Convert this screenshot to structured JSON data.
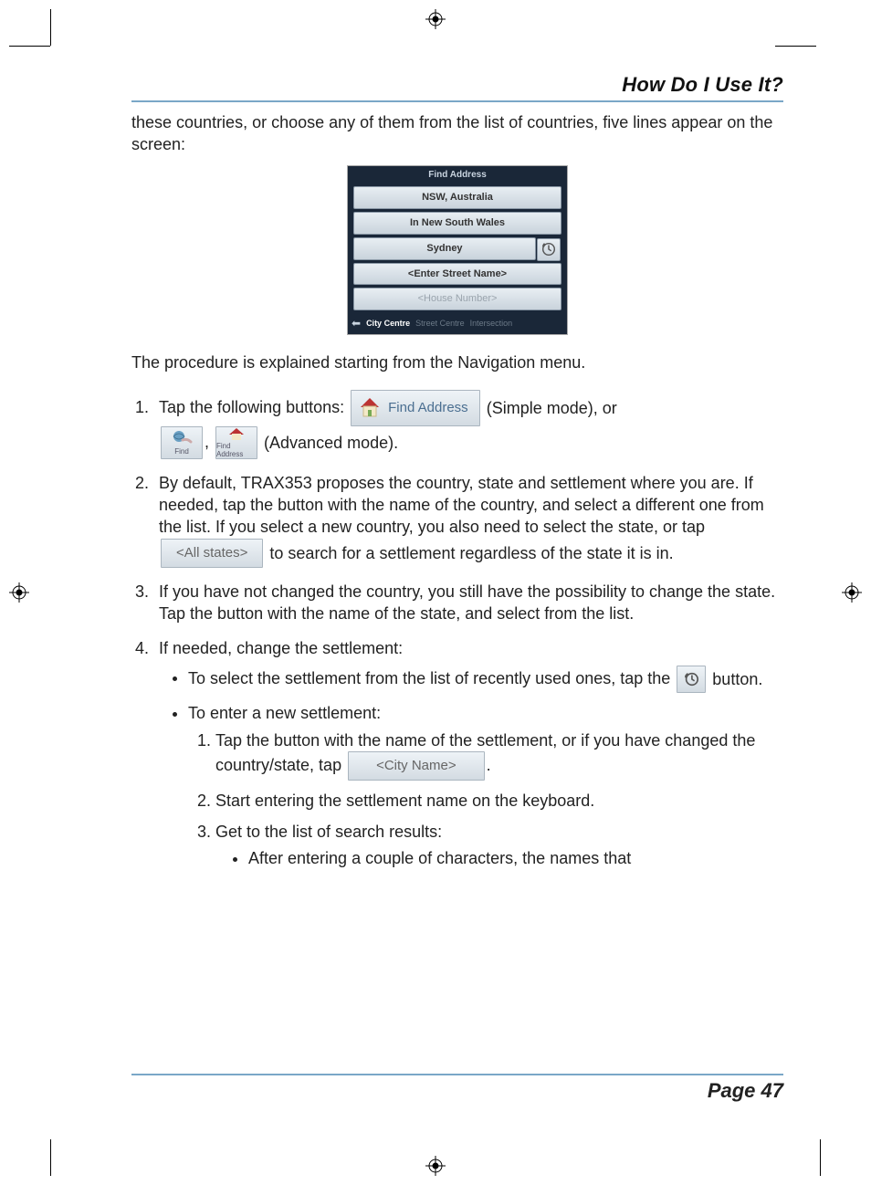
{
  "header": {
    "title": "How Do I Use It?"
  },
  "footer": {
    "label": "Page 47"
  },
  "intro": "these countries, or choose any of them from the list of countries, five lines appear on the screen:",
  "device": {
    "title": "Find Address",
    "row1": "NSW, Australia",
    "row2": "In New South Wales",
    "row3": "Sydney",
    "row4": "<Enter Street Name>",
    "row5": "<House Number>",
    "foot_active": "City Centre",
    "foot_in1": "Street Centre",
    "foot_in2": "Intersection"
  },
  "after_screenshot": "The procedure is explained starting from the Navigation menu.",
  "steps": {
    "s1_a": "Tap the following buttons: ",
    "s1_find_address": "Find Address",
    "s1_b": " (Simple mode), or ",
    "s1_find_small": "Find",
    "s1_findaddr_small": "Find Address",
    "s1_c": " (Advanced mode).",
    "s2_a": "By default, TRAX353 proposes the country, state and settlement where you are. If needed, tap the button with the name of the country, and select a different one from the list. If you select a new country, you also need to select the state, or tap ",
    "s2_chip": "<All states>",
    "s2_b": " to search for a settlement regardless of the state it is in.",
    "s3": "If you have not changed the country, you still have the possibility to change the state. Tap the button with the name of the state, and select from the list.",
    "s4": "If needed, change the settlement:",
    "s4_b1_a": "To select the settlement from the list of recently used ones, tap the ",
    "s4_b1_b": " button.",
    "s4_b2": "To enter a new settlement:",
    "s4_b2_s1_a": "Tap the button with the name of the settlement, or if you have changed the country/state, tap ",
    "s4_b2_s1_chip": "<City Name>",
    "s4_b2_s1_b": ".",
    "s4_b2_s2": "Start entering the settlement name on the keyboard.",
    "s4_b2_s3": "Get to the list of search results:",
    "s4_b2_s3_b1": "After entering a couple of characters, the names that"
  }
}
